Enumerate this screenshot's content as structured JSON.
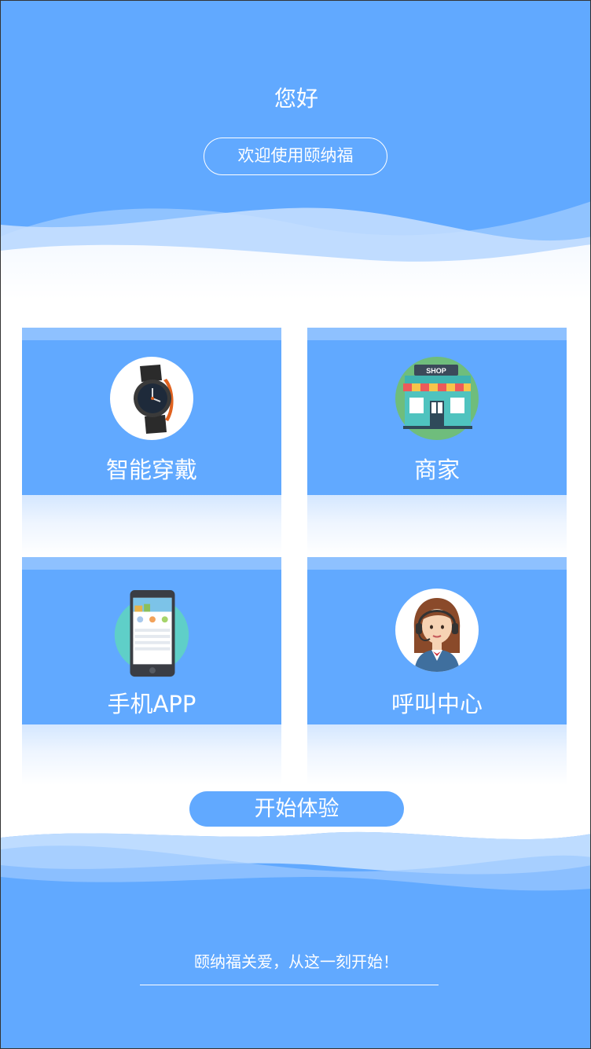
{
  "header": {
    "greeting": "您好",
    "welcome": "欢迎使用颐纳福"
  },
  "tiles": [
    {
      "label": "智能穿戴",
      "icon": "smartwatch-icon"
    },
    {
      "label": "商家",
      "icon": "shop-icon"
    },
    {
      "label": "手机APP",
      "icon": "mobile-app-icon"
    },
    {
      "label": "呼叫中心",
      "icon": "call-center-agent-icon"
    }
  ],
  "shop_sign": "SHOP",
  "start_button": "开始体验",
  "footer": {
    "slogan": "颐纳福关爱，从这一刻开始！"
  },
  "colors": {
    "primary_blue": "#61a9ff",
    "light_blue": "#8ec1ff",
    "white": "#ffffff"
  }
}
